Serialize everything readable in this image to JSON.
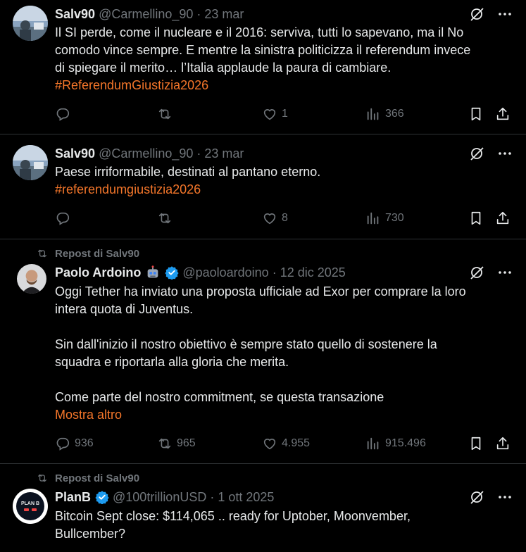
{
  "tweets": [
    {
      "name": "Salv90",
      "handle": "@Carmellino_90",
      "separator": "·",
      "date": "23 mar",
      "lines": [
        "Il SI perde, come il nucleare e il 2016: serviva, tutti lo sapevano, ma il No",
        "comodo vince sempre. E mentre la sinistra politicizza il referendum invece",
        "di spiegare il merito… l’Italia applaude la paura di cambiare."
      ],
      "hashtag": "#ReferendumGiustizia2026",
      "replies": "",
      "reposts": "",
      "likes": "1",
      "views": "366"
    },
    {
      "name": "Salv90",
      "handle": "@Carmellino_90",
      "separator": "·",
      "date": "23 mar",
      "lines": [
        "Paese irriformabile, destinati al pantano eterno."
      ],
      "hashtag": "#referendumgiustizia2026",
      "replies": "",
      "reposts": "",
      "likes": "8",
      "views": "730"
    },
    {
      "repost_label": "Repost di Salv90",
      "name": "Paolo Ardoino",
      "handle": "@paoloardoino",
      "separator": "·",
      "date": "12 dic 2025",
      "paragraphs": [
        [
          "Oggi Tether ha inviato una proposta ufficiale ad Exor per comprare la loro",
          "intera quota di Juventus."
        ],
        [
          "Sin dall'inizio il nostro obiettivo è sempre stato quello di sostenere la",
          "squadra e riportarla alla gloria che merita."
        ],
        [
          "Come parte del nostro commitment, se questa transazione"
        ]
      ],
      "more": "Mostra altro",
      "replies": "936",
      "reposts": "965",
      "likes": "4.955",
      "views": "915.496"
    },
    {
      "repost_label": "Repost di Salv90",
      "name": "PlanB",
      "handle": "@100trillionUSD",
      "separator": "·",
      "date": "1 ott 2025",
      "lines": [
        "Bitcoin Sept close: $114,065 .. ready for Uptober, Moonvember,",
        "Bullcember?"
      ],
      "avatar_text": "PLAN B"
    }
  ],
  "icons": [
    "reply-icon",
    "repost-icon",
    "like-icon",
    "views-icon",
    "bookmark-icon",
    "share-icon",
    "grok-icon",
    "more-icon",
    "verified-icon"
  ],
  "colors": {
    "accent": "#f4762a",
    "muted": "#71767b",
    "text": "#e7e9ea",
    "divider": "#2f3336",
    "verified": "#1d9bf0"
  }
}
